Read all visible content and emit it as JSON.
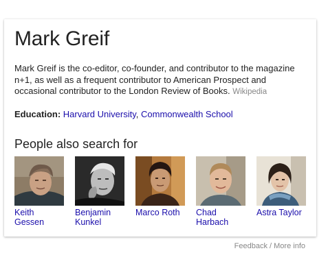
{
  "entity": {
    "name": "Mark Greif",
    "description": "Mark Greif is the co-editor, co-founder, and contributor to the magazine n+1, as well as a frequent contributor to American Prospect and occasional contributor to the London Review of Books.",
    "source_label": "Wikipedia"
  },
  "education": {
    "label": "Education:",
    "schools": [
      "Harvard University",
      "Commonwealth School"
    ],
    "separator": ","
  },
  "related": {
    "heading": "People also search for",
    "people": [
      {
        "name": "Keith Gessen"
      },
      {
        "name": "Benjamin Kunkel"
      },
      {
        "name": "Marco Roth"
      },
      {
        "name": "Chad Harbach"
      },
      {
        "name": "Astra Taylor"
      }
    ]
  },
  "footer": {
    "feedback": "Feedback",
    "divider": "/",
    "more_info": "More info"
  },
  "colors": {
    "link": "#1a0dab",
    "muted": "#878787",
    "text": "#222222"
  }
}
